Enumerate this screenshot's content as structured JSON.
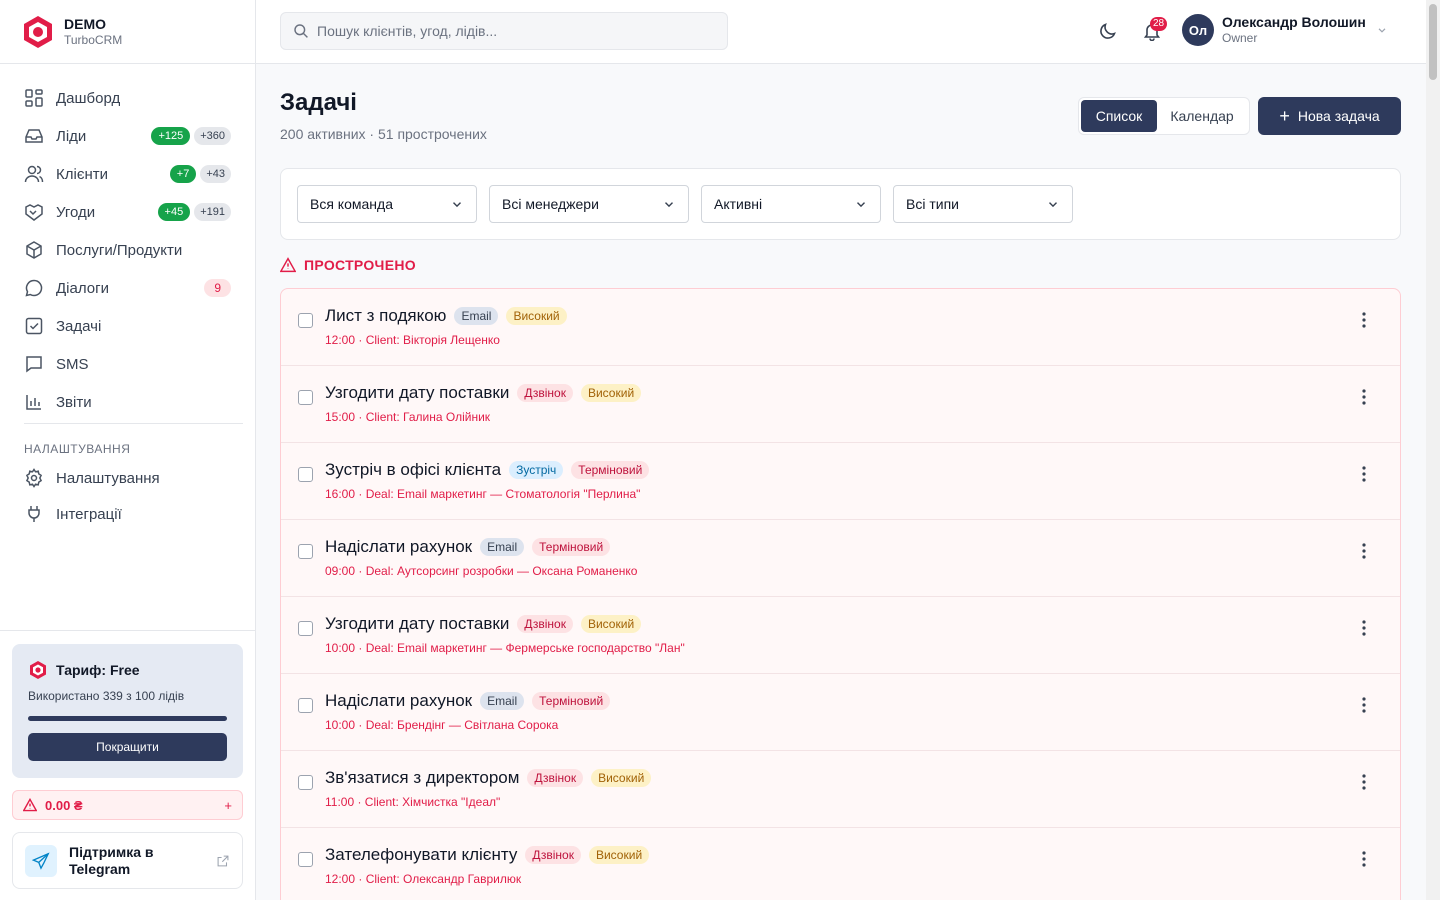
{
  "brand": {
    "name": "DEMO",
    "sub": "TurboCRM"
  },
  "nav": {
    "items": [
      {
        "label": "Дашборд",
        "icon": "dashboard-icon"
      },
      {
        "label": "Ліди",
        "icon": "inbox-icon",
        "badge_new": "+125",
        "badge_total": "+360"
      },
      {
        "label": "Клієнти",
        "icon": "users-icon",
        "badge_new": "+7",
        "badge_total": "+43"
      },
      {
        "label": "Угоди",
        "icon": "handshake-icon",
        "badge_new": "+45",
        "badge_total": "+191"
      },
      {
        "label": "Послуги/Продукти",
        "icon": "box-icon"
      },
      {
        "label": "Діалоги",
        "icon": "chat-icon",
        "badge_count": "9"
      },
      {
        "label": "Задачі",
        "icon": "check-square-icon"
      },
      {
        "label": "SMS",
        "icon": "message-icon"
      },
      {
        "label": "Звіти",
        "icon": "chart-icon"
      }
    ],
    "section_title": "НАЛАШТУВАННЯ",
    "settings_items": [
      {
        "label": "Налаштування",
        "icon": "gear-icon"
      },
      {
        "label": "Інтеграції",
        "icon": "plug-icon"
      }
    ]
  },
  "plan": {
    "title": "Тариф: Free",
    "used": "Використано 339 з 100 лідів",
    "usage_fraction": 1.0,
    "button": "Покращити"
  },
  "balance": {
    "amount": "0.00 ₴",
    "plus": "+"
  },
  "support": {
    "label": "Підтримка в Telegram"
  },
  "topbar": {
    "search_placeholder": "Пошук клієнтів, угод, лідів...",
    "notifications_count": "28",
    "user": {
      "initials": "Ол",
      "name": "Олександр Волошин",
      "role": "Owner"
    }
  },
  "page": {
    "title": "Задачі",
    "subtitle": "200 активних · 51 прострочених",
    "view_list": "Список",
    "view_calendar": "Календар",
    "new_task": "Нова задача"
  },
  "filters": {
    "team": "Вся команда",
    "manager": "Всі менеджери",
    "status": "Активні",
    "type": "Всі типи"
  },
  "overdue": {
    "heading": "ПРОСТРОЧЕНО",
    "tasks": [
      {
        "title": "Лист з подякою",
        "type": "Email",
        "type_kind": "email",
        "priority": "Високий",
        "priority_kind": "high",
        "meta": "12:00 · Client: Вікторія Лещенко"
      },
      {
        "title": "Узгодити дату поставки",
        "type": "Дзвінок",
        "type_kind": "call",
        "priority": "Високий",
        "priority_kind": "high",
        "meta": "15:00 · Client: Галина Олійник"
      },
      {
        "title": "Зустріч в офісі клієнта",
        "type": "Зустріч",
        "type_kind": "meet",
        "priority": "Терміновий",
        "priority_kind": "urgent",
        "meta": "16:00 · Deal: Email маркетинг — Стоматологія \"Перлина\""
      },
      {
        "title": "Надіслати рахунок",
        "type": "Email",
        "type_kind": "email",
        "priority": "Терміновий",
        "priority_kind": "urgent",
        "meta": "09:00 · Deal: Аутсорсинг розробки — Оксана Романенко"
      },
      {
        "title": "Узгодити дату поставки",
        "type": "Дзвінок",
        "type_kind": "call",
        "priority": "Високий",
        "priority_kind": "high",
        "meta": "10:00 · Deal: Email маркетинг — Фермерське господарство \"Лан\""
      },
      {
        "title": "Надіслати рахунок",
        "type": "Email",
        "type_kind": "email",
        "priority": "Терміновий",
        "priority_kind": "urgent",
        "meta": "10:00 · Deal: Брендінг — Світлана Сорока"
      },
      {
        "title": "Зв'язатися з директором",
        "type": "Дзвінок",
        "type_kind": "call",
        "priority": "Високий",
        "priority_kind": "high",
        "meta": "11:00 · Client: Хімчистка \"Ідеал\""
      },
      {
        "title": "Зателефонувати клієнту",
        "type": "Дзвінок",
        "type_kind": "call",
        "priority": "Високий",
        "priority_kind": "high",
        "meta": "12:00 · Client: Олександр Гаврилюк"
      }
    ]
  },
  "colors": {
    "primary": "#2e3a5c",
    "danger": "#e11d48",
    "success": "#16a34a"
  }
}
